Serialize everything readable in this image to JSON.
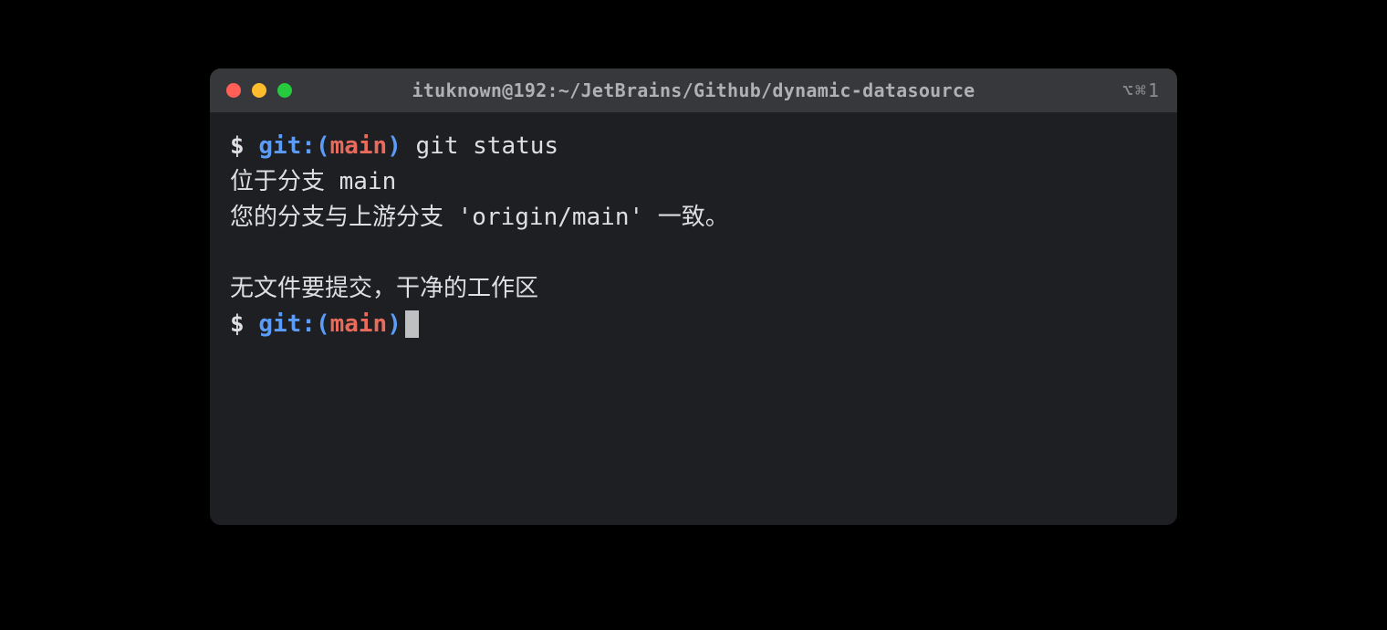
{
  "window": {
    "title": "ituknown@192:~/JetBrains/Github/dynamic-datasource",
    "tabIndicator": "⌥⌘1"
  },
  "prompt": {
    "symbol": "$ ",
    "gitLabel": "git:",
    "parenOpen": "(",
    "branch": "main",
    "parenClose": ")"
  },
  "lines": {
    "command1": " git status",
    "output1": "位于分支 main",
    "output2": "您的分支与上游分支 'origin/main' 一致。",
    "output3": "无文件要提交，干净的工作区"
  },
  "colors": {
    "background": "#000000",
    "terminalBg": "#1e1f22",
    "titleBarBg": "#37383c",
    "textDefault": "#dedfe1",
    "gitBlue": "#5a9cf8",
    "branchRed": "#e86b5c",
    "trafficClose": "#ff5f56",
    "trafficMin": "#ffbd2e",
    "trafficMax": "#27c93f"
  }
}
